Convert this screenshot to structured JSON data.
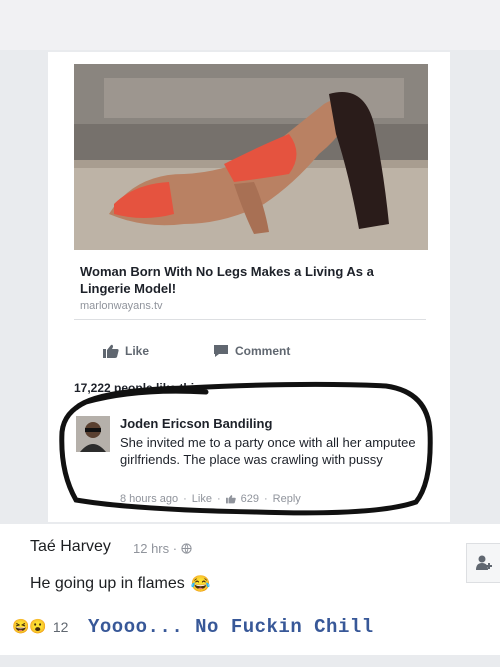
{
  "post": {
    "link_title": "Woman Born With No Legs Makes a Living As a Lingerie Model!",
    "link_domain": "marlonwayans.tv",
    "like_label": "Like",
    "comment_label": "Comment",
    "likes_summary": "17,222 people like this."
  },
  "comment": {
    "author": "Joden Ericson Bandiling",
    "text": "She invited me to a party once with all her amputee girlfriends. The place was crawling with pussy",
    "time": "8 hours ago",
    "like_label": "Like",
    "reaction_count": "629",
    "reply_label": "Reply",
    "separator": "·"
  },
  "reply1": {
    "author": "Taé Harvey",
    "time": "12 hrs ·",
    "text": "He going up in flames",
    "emoji": "😂"
  },
  "reply2": {
    "reaction_emojis": "😆😮",
    "reaction_count": "12",
    "text": "Yoooo... No Fuckin Chill"
  },
  "icons": {
    "like": "thumbs-up-icon",
    "comment": "speech-bubble-icon",
    "globe": "globe-icon",
    "add_friend": "add-friend-icon"
  },
  "colors": {
    "annotation": "#111111",
    "link": "#385898",
    "meta": "#90949c"
  }
}
